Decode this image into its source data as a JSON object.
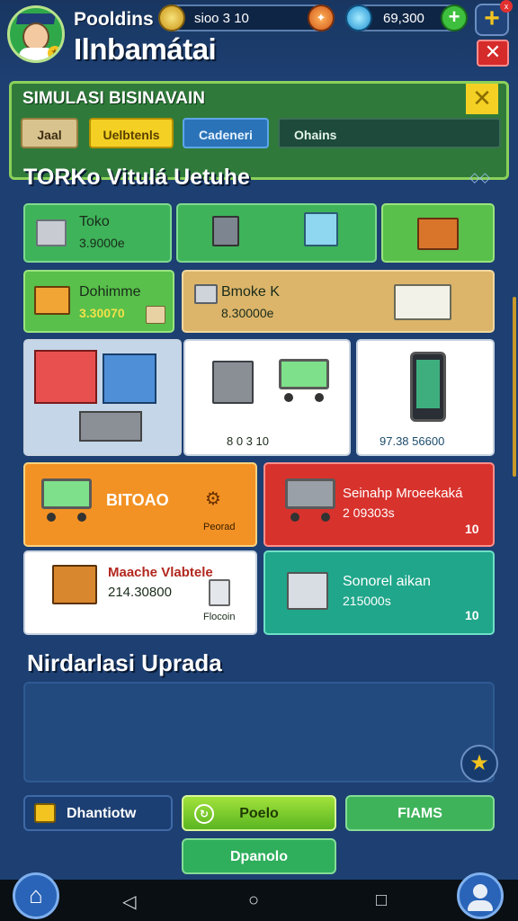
{
  "header": {
    "player_name": "Pooldins",
    "company_name": "Ilnbamátai",
    "coins": "sioo 3 10",
    "gems": "69,300"
  },
  "panel": {
    "title": "SIMULASI BISINAVAIN",
    "tabs": [
      "Jaal",
      "Uelbtenls",
      "Cadeneri",
      "Ohains"
    ]
  },
  "shop": {
    "title": "TORKo Vitulá Uetuhe",
    "cards": {
      "toko": {
        "label": "Toko",
        "value": "3.9000e"
      },
      "dohimme": {
        "label": "Dohimme",
        "value": "3.30070"
      },
      "bmoke": {
        "label": "Bmoke K",
        "value": "8.30000e"
      },
      "cart_caption": "8 0 3 10",
      "phone_caption": "97.38 56600",
      "btoao": {
        "label": "BITOAO",
        "caption": "Peorad"
      },
      "seinahp": {
        "label": "Seinahp Mroeekaká",
        "value": "2 09303s",
        "count": "10"
      },
      "mache": {
        "label": "Maache Vlabtele",
        "value": "214.30800",
        "caption": "Flocoin"
      },
      "sonorel": {
        "label": "Sonorel aikan",
        "value": "215000s",
        "count": "10"
      }
    }
  },
  "notifications": {
    "title": "Nirdarlasi Uprada"
  },
  "actions": {
    "b1": "Dhantiotw",
    "b2": "Poelo",
    "b3": "FIAMS",
    "b4": "Dpanolo"
  },
  "colors": {
    "accent": "#f3d023",
    "panel": "#2f7a3a",
    "background": "#1d3f72"
  }
}
